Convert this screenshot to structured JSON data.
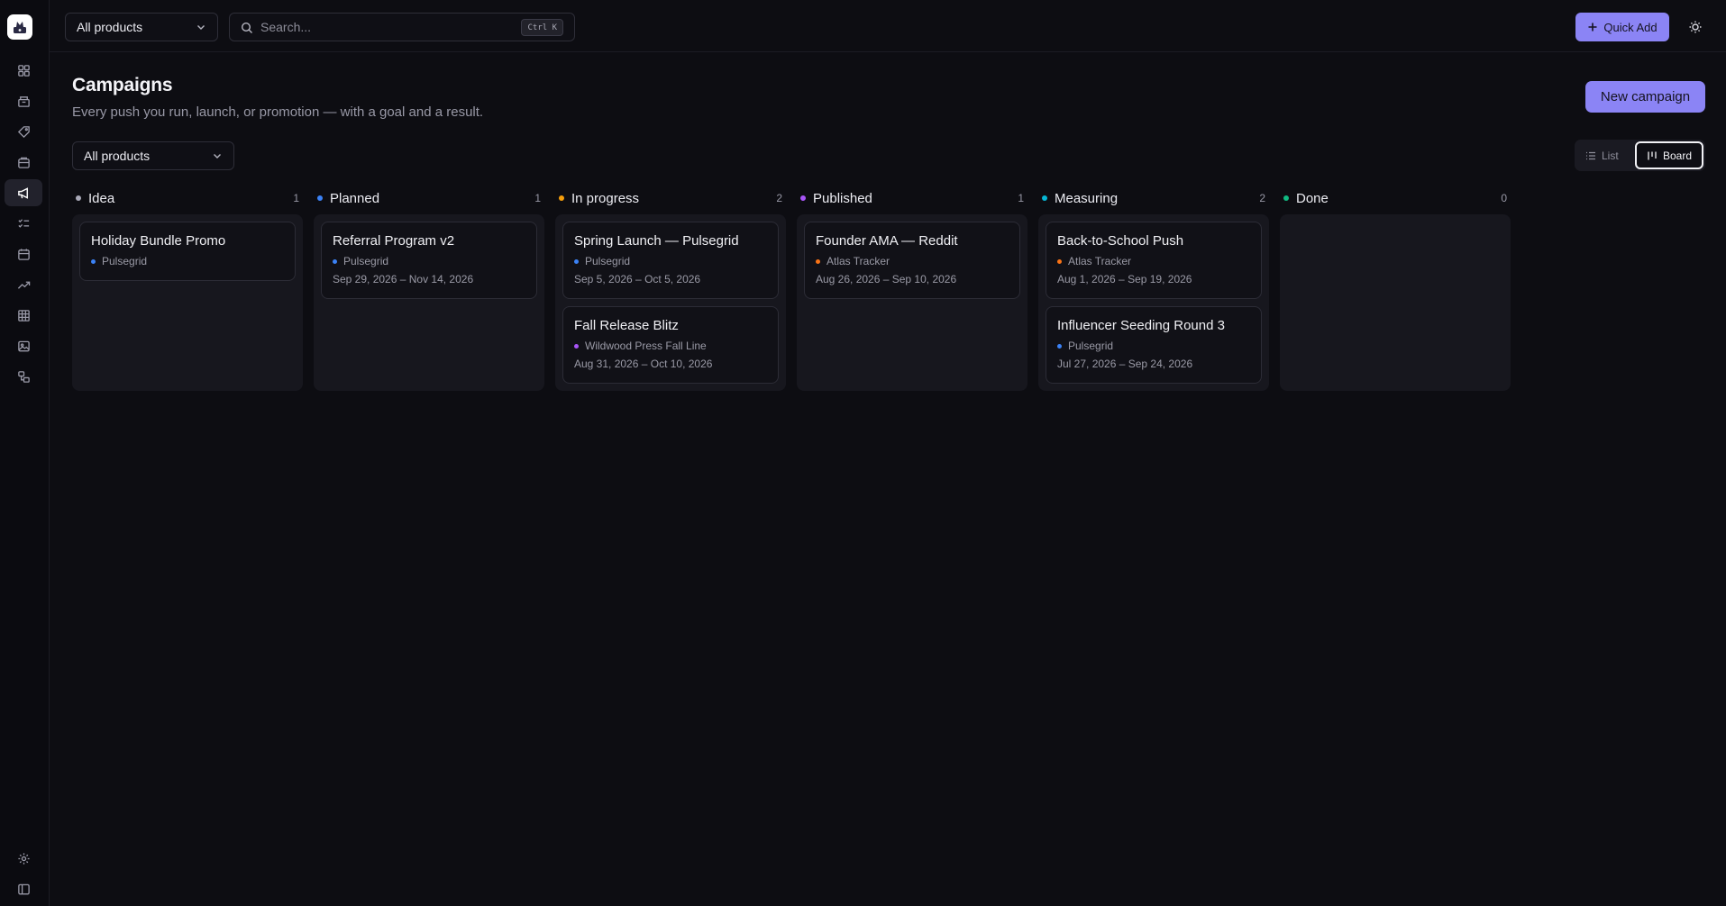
{
  "topbar": {
    "product_select": "All products",
    "search_placeholder": "Search...",
    "search_shortcut": "Ctrl K",
    "quick_add_label": "Quick Add"
  },
  "sidebar": {
    "items": [
      {
        "icon": "dashboard-icon"
      },
      {
        "icon": "products-icon"
      },
      {
        "icon": "tags-icon"
      },
      {
        "icon": "assets-icon"
      },
      {
        "icon": "megaphone-icon",
        "active": true
      },
      {
        "icon": "tasks-icon"
      },
      {
        "icon": "calendar-icon"
      },
      {
        "icon": "analytics-icon"
      },
      {
        "icon": "grid-icon"
      },
      {
        "icon": "image-icon"
      },
      {
        "icon": "integrations-icon"
      }
    ],
    "bottom": [
      {
        "icon": "settings-icon"
      },
      {
        "icon": "collapse-sidebar-icon"
      }
    ]
  },
  "header": {
    "title": "Campaigns",
    "subtitle": "Every push you run, launch, or promotion — with a goal and a result.",
    "new_campaign_label": "New campaign",
    "filter_select": "All products"
  },
  "view_toggle": {
    "list_label": "List",
    "board_label": "Board",
    "active": "Board"
  },
  "colors": {
    "accent": "#8b84f5",
    "idea": "#a9a9b8",
    "planned": "#3b82f6",
    "in_progress": "#f59e0b",
    "published": "#a855f7",
    "measuring": "#06b6d4",
    "done": "#10b981",
    "pulsegrid": "#3b82f6",
    "atlas_tracker": "#f97316",
    "wildwood": "#a855f7"
  },
  "board": {
    "columns": [
      {
        "name": "Idea",
        "count": "1",
        "color": "#a9a9b8",
        "cards": [
          {
            "title": "Holiday Bundle Promo",
            "product": "Pulsegrid",
            "product_color": "#3b82f6",
            "dates": ""
          }
        ]
      },
      {
        "name": "Planned",
        "count": "1",
        "color": "#3b82f6",
        "cards": [
          {
            "title": "Referral Program v2",
            "product": "Pulsegrid",
            "product_color": "#3b82f6",
            "dates": "Sep 29, 2026 – Nov 14, 2026"
          }
        ]
      },
      {
        "name": "In progress",
        "count": "2",
        "color": "#f59e0b",
        "cards": [
          {
            "title": "Spring Launch — Pulsegrid",
            "product": "Pulsegrid",
            "product_color": "#3b82f6",
            "dates": "Sep 5, 2026 – Oct 5, 2026"
          },
          {
            "title": "Fall Release Blitz",
            "product": "Wildwood Press Fall Line",
            "product_color": "#a855f7",
            "dates": "Aug 31, 2026 – Oct 10, 2026"
          }
        ]
      },
      {
        "name": "Published",
        "count": "1",
        "color": "#a855f7",
        "cards": [
          {
            "title": "Founder AMA — Reddit",
            "product": "Atlas Tracker",
            "product_color": "#f97316",
            "dates": "Aug 26, 2026 – Sep 10, 2026"
          }
        ]
      },
      {
        "name": "Measuring",
        "count": "2",
        "color": "#06b6d4",
        "cards": [
          {
            "title": "Back-to-School Push",
            "product": "Atlas Tracker",
            "product_color": "#f97316",
            "dates": "Aug 1, 2026 – Sep 19, 2026"
          },
          {
            "title": "Influencer Seeding Round 3",
            "product": "Pulsegrid",
            "product_color": "#3b82f6",
            "dates": "Jul 27, 2026 – Sep 24, 2026"
          }
        ]
      },
      {
        "name": "Done",
        "count": "0",
        "color": "#10b981",
        "cards": []
      }
    ]
  }
}
